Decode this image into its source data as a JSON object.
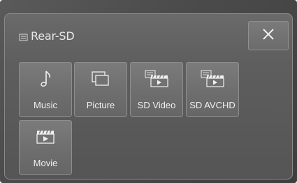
{
  "header": {
    "title": "Rear-SD",
    "source_icon": "sd-card-icon",
    "close_icon": "close-icon"
  },
  "tiles": [
    {
      "label": "Music",
      "icon": "music-note-icon"
    },
    {
      "label": "Picture",
      "icon": "picture-icon"
    },
    {
      "label": "SD Video",
      "icon": "sd-video-icon"
    },
    {
      "label": "SD AVCHD",
      "icon": "sd-avchd-icon"
    },
    {
      "label": "Movie",
      "icon": "movie-icon"
    }
  ],
  "colors": {
    "background": "#4b4b4b",
    "tile": "#6e6e6e",
    "text": "#f0f0f0"
  }
}
